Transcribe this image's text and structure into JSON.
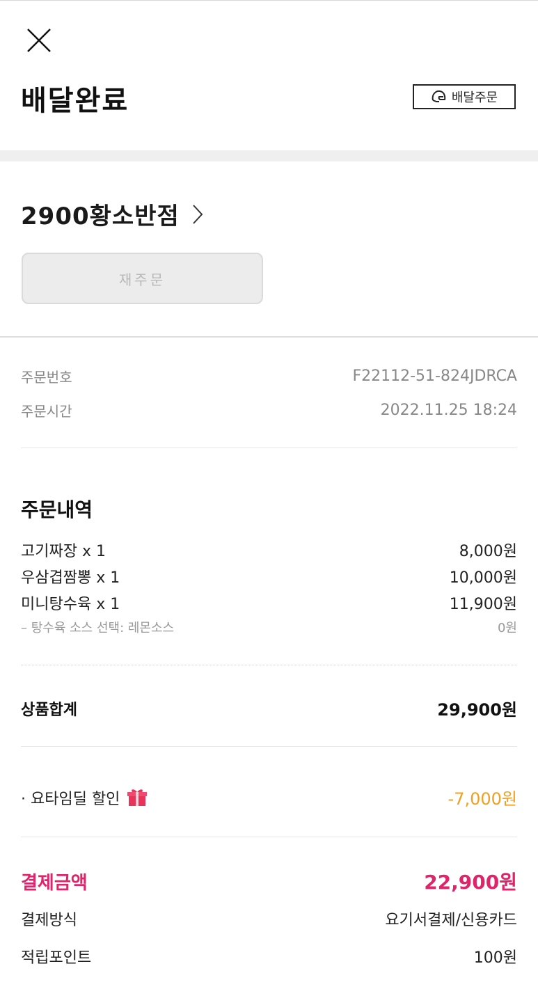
{
  "header": {
    "title": "배달완료",
    "delivery_badge": "배달주문"
  },
  "store": {
    "name": "2900황소반점",
    "reorder_label": "재주문"
  },
  "order_info": {
    "number_label": "주문번호",
    "number_value": "F22112-51-824JDRCA",
    "time_label": "주문시간",
    "time_value": "2022.11.25 18:24"
  },
  "order_details": {
    "title": "주문내역",
    "items": [
      {
        "name": "고기짜장 x 1",
        "price": "8,000원"
      },
      {
        "name": "우삼겹짬뽕 x 1",
        "price": "10,000원"
      },
      {
        "name": "미니탕수육 x 1",
        "price": "11,900원"
      }
    ],
    "option": {
      "name": "– 탕수육 소스 선택: 레몬소스",
      "price": "0원"
    }
  },
  "totals": {
    "subtotal_label": "상품합계",
    "subtotal_value": "29,900원",
    "discount_label": "· 요타임딜 할인",
    "discount_value": "-7,000원",
    "payment_label": "결제금액",
    "payment_value": "22,900원",
    "method_label": "결제방식",
    "method_value": "요기서결제/신용카드",
    "points_label": "적립포인트",
    "points_value": "100원"
  },
  "colors": {
    "accent_pink": "#e0246a",
    "discount_orange": "#f0a020",
    "gift_icon": "#e8335a"
  },
  "icons": [
    "close-icon",
    "helmet-icon",
    "chevron-right-icon",
    "gift-icon"
  ]
}
